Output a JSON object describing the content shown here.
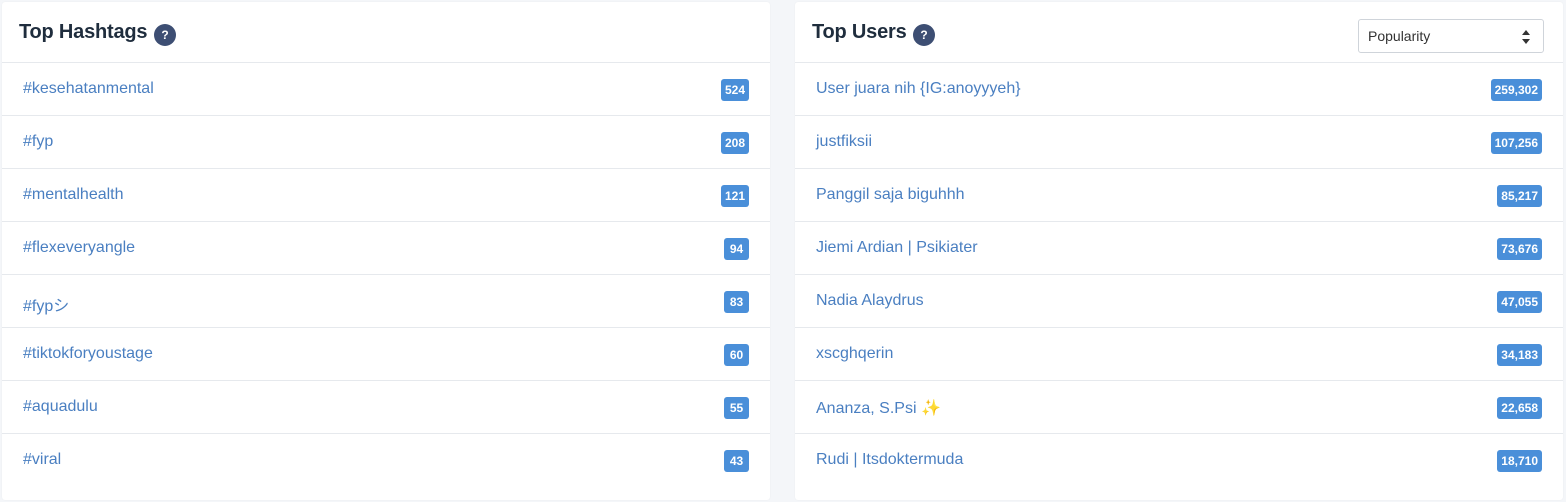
{
  "hashtags": {
    "title": "Top Hashtags",
    "help": "?",
    "items": [
      {
        "label": "#kesehatanmental",
        "count": "524"
      },
      {
        "label": "#fyp",
        "count": "208"
      },
      {
        "label": "#mentalhealth",
        "count": "121"
      },
      {
        "label": "#flexeveryangle",
        "count": "94"
      },
      {
        "label": "#fypシ",
        "count": "83"
      },
      {
        "label": "#tiktokforyoustage",
        "count": "60"
      },
      {
        "label": "#aquadulu",
        "count": "55"
      },
      {
        "label": "#viral",
        "count": "43"
      }
    ]
  },
  "users": {
    "title": "Top Users",
    "help": "?",
    "sort": {
      "selected": "Popularity"
    },
    "items": [
      {
        "label": "User juara nih {IG:anoyyyeh}",
        "count": "259,302"
      },
      {
        "label": "justfiksii",
        "count": "107,256"
      },
      {
        "label": "Panggil saja biguhhh",
        "count": "85,217"
      },
      {
        "label": "Jiemi Ardian | Psikiater",
        "count": "73,676"
      },
      {
        "label": "Nadia Alaydrus",
        "count": "47,055"
      },
      {
        "label": "xscghqerin",
        "count": "34,183"
      },
      {
        "label": "Ananza, S.Psi ✨",
        "count": "22,658"
      },
      {
        "label": "Rudi | Itsdoktermuda",
        "count": "18,710"
      }
    ]
  }
}
